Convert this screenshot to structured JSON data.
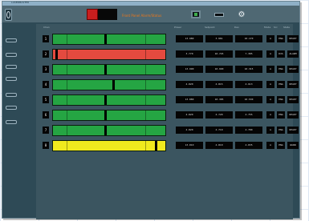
{
  "window": {
    "title": "LASERMASTER"
  },
  "header": {
    "status_text": "Front Panel Alarm/Status",
    "accent_red": "#c81e1e",
    "status_text_color": "#f07818"
  },
  "table": {
    "columns": [
      "Chan",
      "Power",
      "Setpoint",
      "Dev",
      "Mode",
      "Src",
      "State",
      "Out",
      "Run"
    ],
    "lanes": [
      {
        "num": "1",
        "color": "green",
        "indicator": 0.47,
        "cells": [
          "13.980",
          "3.981",
          "10.170",
          "A",
          "ENA",
          "READY"
        ]
      },
      {
        "num": "2",
        "color": "red",
        "indicator": 0.02,
        "cells": [
          "3.770",
          "10.745",
          "7.385",
          "A",
          "DIS",
          "ALARM"
        ]
      },
      {
        "num": "3",
        "color": "green",
        "indicator": 0.47,
        "cells": [
          "13.990",
          "10.990",
          "10.315",
          "A",
          "ENA",
          "READY"
        ]
      },
      {
        "num": "4",
        "color": "green",
        "indicator": 0.54,
        "cells": [
          "4.820",
          "4.815",
          "4.613",
          "A",
          "ENA",
          "READY"
        ]
      },
      {
        "num": "5",
        "color": "green",
        "indicator": 0.47,
        "cells": [
          "13.880",
          "10.385",
          "10.530",
          "A",
          "ENA",
          "READY"
        ]
      },
      {
        "num": "6",
        "color": "green",
        "indicator": 0.47,
        "cells": [
          "4.820",
          "4.720",
          "4.755",
          "A",
          "ENA",
          "READY"
        ]
      },
      {
        "num": "7",
        "color": "green",
        "indicator": 0.47,
        "cells": [
          "4.820",
          "4.710",
          "4.780",
          "A",
          "ENA",
          "READY"
        ]
      },
      {
        "num": "8",
        "color": "yellow",
        "indicator": 0.93,
        "cells": [
          "13.010",
          "4.810",
          "4.835",
          "A",
          "ENA",
          "WARN"
        ]
      }
    ]
  }
}
